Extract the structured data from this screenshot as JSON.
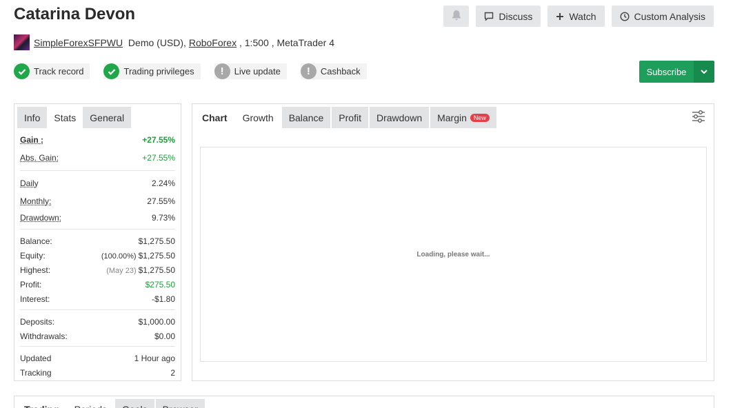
{
  "header": {
    "title": "Catarina Devon",
    "buttons": {
      "discuss": "Discuss",
      "watch": "Watch",
      "custom_analysis": "Custom Analysis"
    }
  },
  "account": {
    "username": "SimpleForexSFPWU",
    "type": "Demo (USD),",
    "broker": "RoboForex",
    "leverage": ", 1:500 , MetaTrader 4"
  },
  "badges": [
    {
      "label": "Track record",
      "status": "verified"
    },
    {
      "label": "Trading privileges",
      "status": "verified"
    },
    {
      "label": "Live update",
      "status": "unverified"
    },
    {
      "label": "Cashback",
      "status": "unverified"
    }
  ],
  "subscribe": {
    "label": "Subscribe"
  },
  "left_panel": {
    "tabs": [
      "Info",
      "Stats",
      "General"
    ],
    "stats": {
      "gain": {
        "label": "Gain :",
        "value": "+27.55%"
      },
      "abs_gain": {
        "label": "Abs. Gain:",
        "value": "+27.55%"
      },
      "daily": {
        "label": "Daily",
        "value": "2.24%"
      },
      "monthly": {
        "label": "Monthly:",
        "value": "27.55%"
      },
      "drawdown": {
        "label": "Drawdown:",
        "value": "9.73%"
      },
      "balance": {
        "label": "Balance:",
        "value": "$1,275.50"
      },
      "equity": {
        "label": "Equity:",
        "note": "(100.00%)",
        "value": "$1,275.50"
      },
      "highest": {
        "label": "Highest:",
        "note": "(May 23)",
        "value": "$1,275.50"
      },
      "profit": {
        "label": "Profit:",
        "value": "$275.50"
      },
      "interest": {
        "label": "Interest:",
        "value": "-$1.80"
      },
      "deposits": {
        "label": "Deposits:",
        "value": "$1,000.00"
      },
      "withdrawals": {
        "label": "Withdrawals:",
        "value": "$0.00"
      },
      "updated": {
        "label": "Updated",
        "value": "1 Hour ago"
      },
      "tracking": {
        "label": "Tracking",
        "value": "2"
      }
    }
  },
  "chart_panel": {
    "tabs": [
      "Chart",
      "Growth",
      "Balance",
      "Profit",
      "Drawdown",
      "Margin"
    ],
    "new_tag": "New",
    "loading": "Loading, please wait..."
  },
  "bottom_panel": {
    "tabs": [
      "Trading",
      "Periods",
      "Goals",
      "Browser"
    ]
  },
  "colors": {
    "green": "#1e9e5b",
    "positive": "#1e9e3a",
    "new_badge": "#e2404a"
  }
}
